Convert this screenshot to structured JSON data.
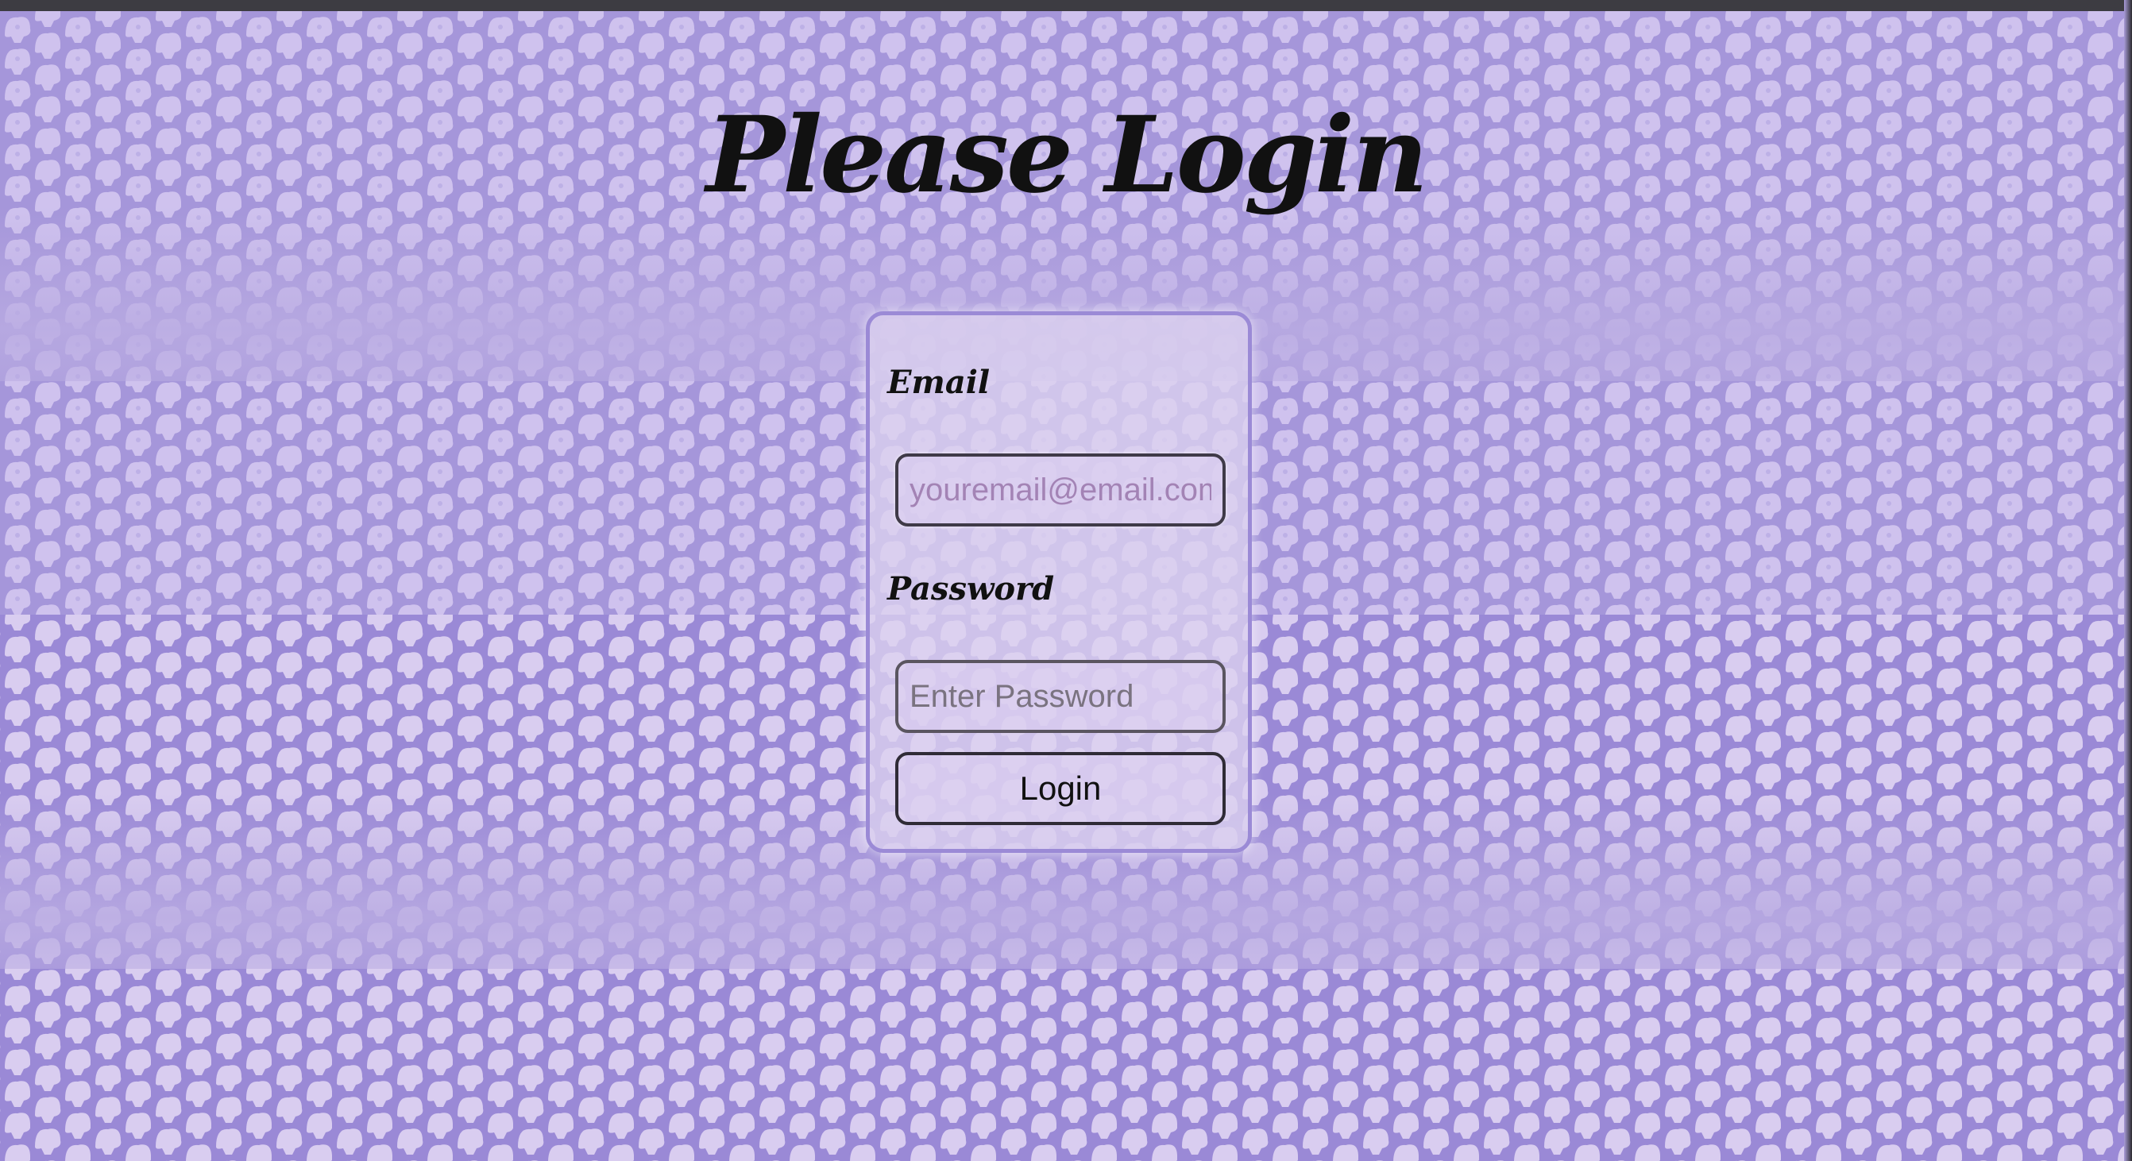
{
  "page": {
    "title": "Please Login"
  },
  "login_form": {
    "email_label": "Email",
    "email_placeholder": "youremail@email.com",
    "email_value": "",
    "password_label": "Password",
    "password_placeholder": "Enter Password",
    "password_value": "",
    "submit_label": "Login"
  },
  "colors": {
    "background": "#b9abe2",
    "pattern_light": "#d9cdf0",
    "pattern_dark": "#9a89d6",
    "card_border": "#9b8ad6",
    "title_text": "#111111",
    "email_placeholder": "#a383b5"
  },
  "icons": {
    "background_pattern": "scallop-flower-pattern"
  }
}
